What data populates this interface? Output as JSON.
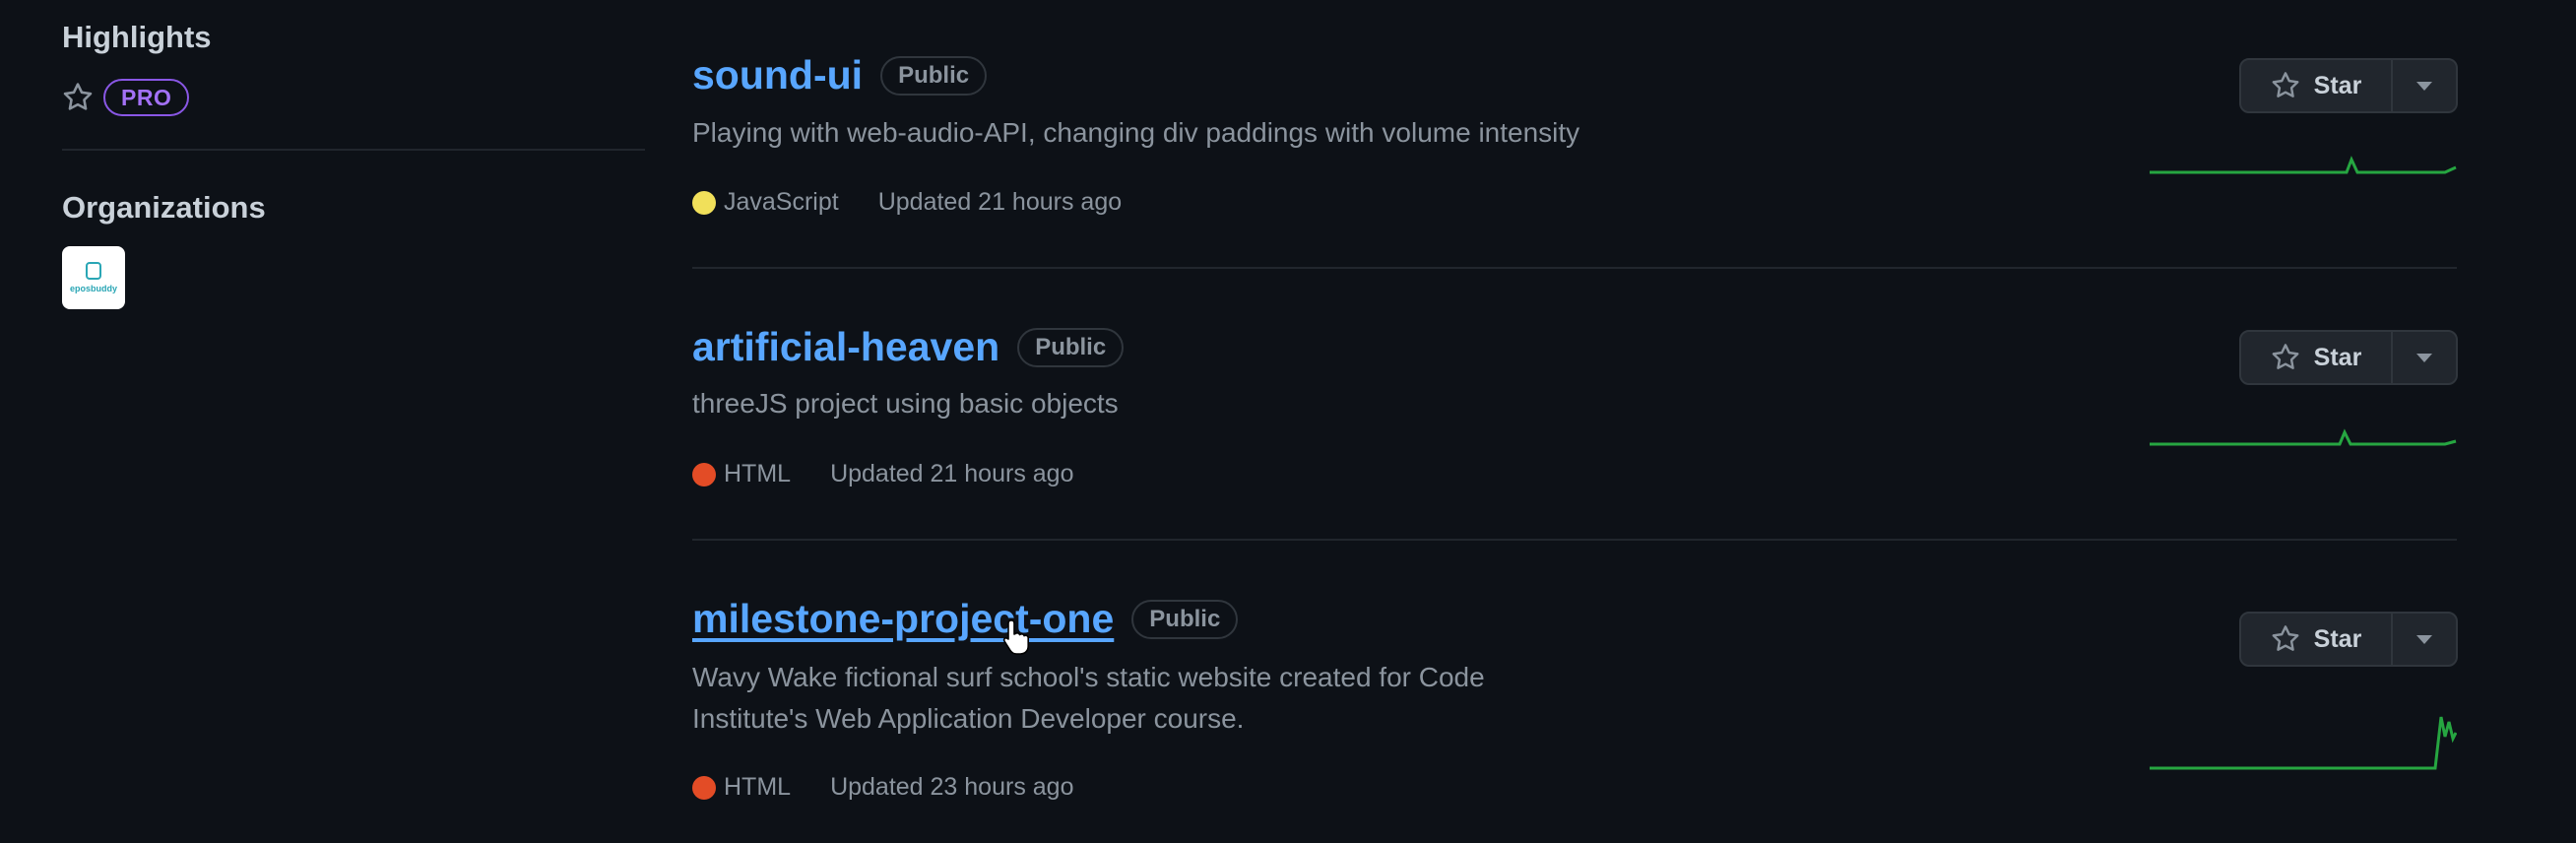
{
  "sidebar": {
    "highlights_heading": "Highlights",
    "pro_badge": "PRO",
    "organizations_heading": "Organizations",
    "org_logo_text": "eposbuddy"
  },
  "repos": [
    {
      "name": "sound-ui",
      "visibility": "Public",
      "description": "Playing with web-audio-API, changing div paddings with volume intensity",
      "language": "JavaScript",
      "language_color": "#f1e05a",
      "updated": "Updated 21 hours ago",
      "star_label": "Star"
    },
    {
      "name": "artificial-heaven",
      "visibility": "Public",
      "description": "threeJS project using basic objects",
      "language": "HTML",
      "language_color": "#e34c26",
      "updated": "Updated 21 hours ago",
      "star_label": "Star"
    },
    {
      "name": "milestone-project-one",
      "visibility": "Public",
      "description": "Wavy Wake fictional surf school's static website created for Code Institute's Web Application Developer course.",
      "language": "HTML",
      "language_color": "#e34c26",
      "updated": "Updated 23 hours ago",
      "star_label": "Star"
    }
  ],
  "colors": {
    "background": "#0d1117",
    "link": "#58a6ff",
    "muted": "#8b949e",
    "pro_accent": "#a371f7",
    "sparkline": "#26a641"
  },
  "icons": [
    "star-icon",
    "chevron-down-icon",
    "pointer-cursor-icon"
  ]
}
